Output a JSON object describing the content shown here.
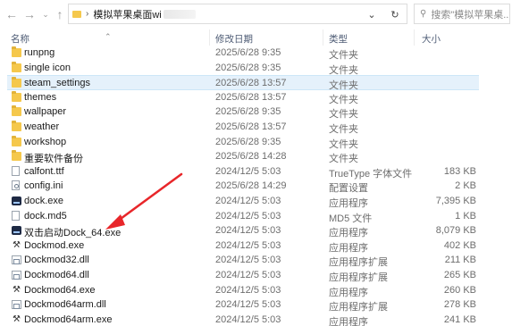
{
  "address_bar": {
    "path_label": "模拟苹果桌面wi",
    "search_placeholder": "搜索\"模拟苹果桌..."
  },
  "columns": {
    "name": "名称",
    "date": "修改日期",
    "type": "类型",
    "size": "大小"
  },
  "files": [
    {
      "name": "runpng",
      "date": "2025/6/28 9:35",
      "type": "文件夹",
      "size": "",
      "icon": "folder-icon"
    },
    {
      "name": "single icon",
      "date": "2025/6/28 9:35",
      "type": "文件夹",
      "size": "",
      "icon": "folder-icon"
    },
    {
      "name": "steam_settings",
      "date": "2025/6/28 13:57",
      "type": "文件夹",
      "size": "",
      "icon": "folder-icon"
    },
    {
      "name": "themes",
      "date": "2025/6/28 13:57",
      "type": "文件夹",
      "size": "",
      "icon": "folder-icon"
    },
    {
      "name": "wallpaper",
      "date": "2025/6/28 9:35",
      "type": "文件夹",
      "size": "",
      "icon": "folder-icon"
    },
    {
      "name": "weather",
      "date": "2025/6/28 13:57",
      "type": "文件夹",
      "size": "",
      "icon": "folder-icon"
    },
    {
      "name": "workshop",
      "date": "2025/6/28 9:35",
      "type": "文件夹",
      "size": "",
      "icon": "folder-icon"
    },
    {
      "name": "重要软件备份",
      "date": "2025/6/28 14:28",
      "type": "文件夹",
      "size": "",
      "icon": "folder-icon"
    },
    {
      "name": "calfont.ttf",
      "date": "2024/12/5 5:03",
      "type": "TrueType 字体文件",
      "size": "183 KB",
      "icon": "font-file-icon"
    },
    {
      "name": "config.ini",
      "date": "2025/6/28 14:29",
      "type": "配置设置",
      "size": "2 KB",
      "icon": "config-file-icon"
    },
    {
      "name": "dock.exe",
      "date": "2024/12/5 5:03",
      "type": "应用程序",
      "size": "7,395 KB",
      "icon": "app-icon"
    },
    {
      "name": "dock.md5",
      "date": "2024/12/5 5:03",
      "type": "MD5 文件",
      "size": "1 KB",
      "icon": "file-icon"
    },
    {
      "name": "双击启动Dock_64.exe",
      "date": "2024/12/5 5:03",
      "type": "应用程序",
      "size": "8,079 KB",
      "icon": "app-icon"
    },
    {
      "name": "Dockmod.exe",
      "date": "2024/12/5 5:03",
      "type": "应用程序",
      "size": "402 KB",
      "icon": "tool-icon"
    },
    {
      "name": "Dockmod32.dll",
      "date": "2024/12/5 5:03",
      "type": "应用程序扩展",
      "size": "211 KB",
      "icon": "dll-icon"
    },
    {
      "name": "Dockmod64.dll",
      "date": "2024/12/5 5:03",
      "type": "应用程序扩展",
      "size": "265 KB",
      "icon": "dll-icon"
    },
    {
      "name": "Dockmod64.exe",
      "date": "2024/12/5 5:03",
      "type": "应用程序",
      "size": "260 KB",
      "icon": "tool-icon"
    },
    {
      "name": "Dockmod64arm.dll",
      "date": "2024/12/5 5:03",
      "type": "应用程序扩展",
      "size": "278 KB",
      "icon": "dll-icon"
    },
    {
      "name": "Dockmod64arm.exe",
      "date": "2024/12/5 5:03",
      "type": "应用程序",
      "size": "241 KB",
      "icon": "tool-icon"
    }
  ],
  "selected_file_index": 2,
  "colors": {
    "selection_bg": "#e5f1fb",
    "annotation_arrow": "#e8262a"
  }
}
